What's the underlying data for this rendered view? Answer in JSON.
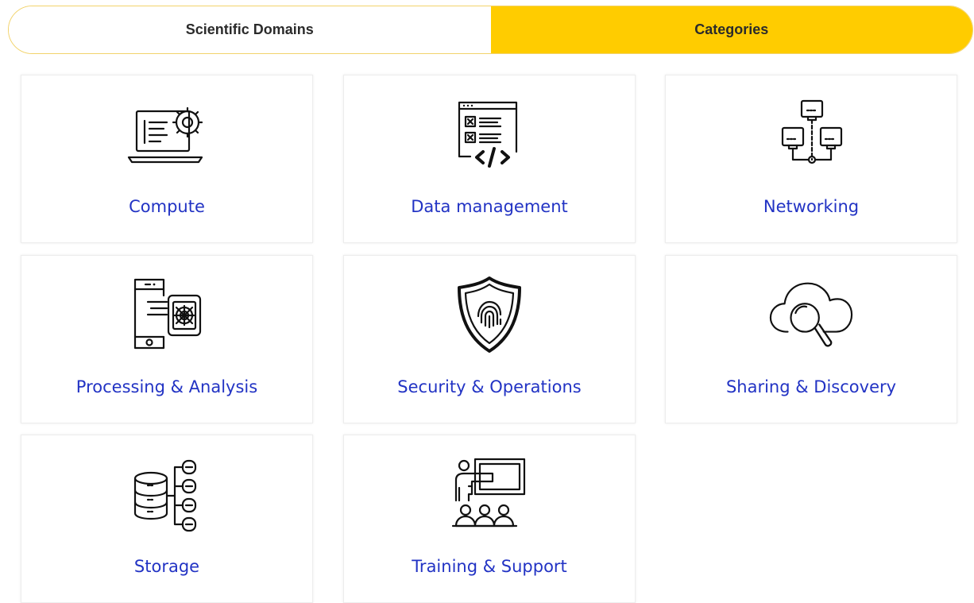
{
  "tabs": [
    {
      "label": "Scientific Domains",
      "active": false
    },
    {
      "label": "Categories",
      "active": true
    }
  ],
  "colors": {
    "accent": "#ffcc00",
    "link": "#2233c4",
    "text": "#2b2b2b"
  },
  "categories": [
    {
      "label": "Compute",
      "icon": "laptop-gear-icon"
    },
    {
      "label": "Data management",
      "icon": "code-window-icon"
    },
    {
      "label": "Networking",
      "icon": "network-monitors-icon"
    },
    {
      "label": "Processing & Analysis",
      "icon": "phone-chip-icon"
    },
    {
      "label": "Security & Operations",
      "icon": "shield-fingerprint-icon"
    },
    {
      "label": "Sharing & Discovery",
      "icon": "cloud-search-icon"
    },
    {
      "label": "Storage",
      "icon": "database-tree-icon"
    },
    {
      "label": "Training & Support",
      "icon": "presentation-board-icon"
    }
  ]
}
